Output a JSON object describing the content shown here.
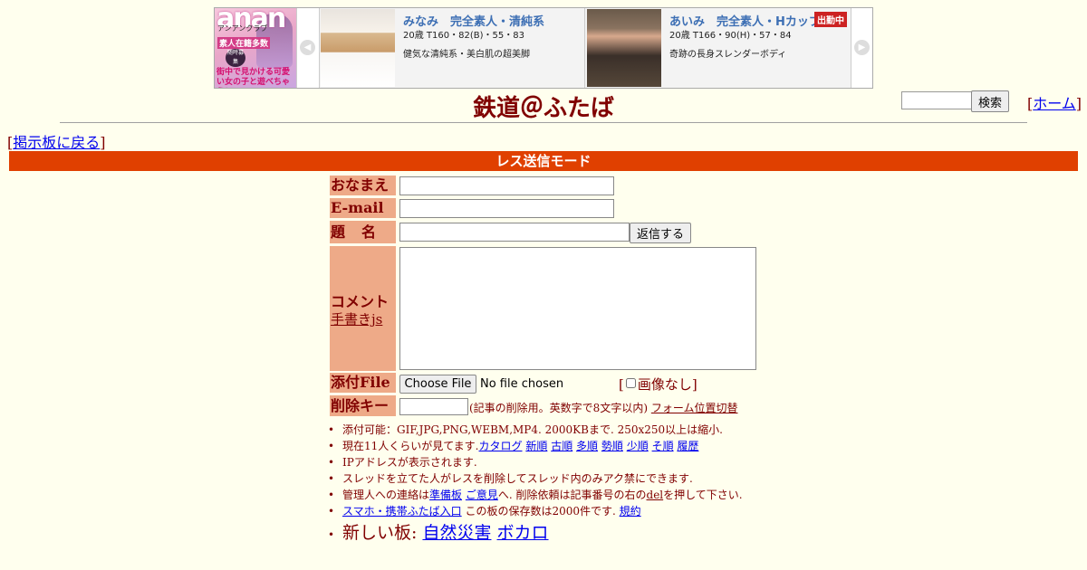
{
  "ad": {
    "logo": {
      "brand": "anan",
      "sub": "アンアンクラブ",
      "mid": "素人在籍多数",
      "bubble": "随時募集",
      "tagline": "街中で見かける可愛い女の子と遊べちゃう！"
    },
    "cards": [
      {
        "name": "みなみ　完全素人・清純系",
        "stats": "20歳 T160・82(B)・55・83",
        "desc": "健気な清純系・美白肌の超美脚",
        "badge": ""
      },
      {
        "name": "あいみ　完全素人・Hカップ",
        "stats": "20歳 T166・90(H)・57・84",
        "desc": "奇跡の長身スレンダーボディ",
        "badge": "出勤中"
      }
    ],
    "prev_glyph": "◀",
    "next_glyph": "▶"
  },
  "header": {
    "title": "鉄道＠ふたば",
    "search_button": "検索",
    "search_placeholder": "",
    "home_link": "ホーム",
    "back_link": "掲示板に戻る"
  },
  "mode_bar": "レス送信モード",
  "form": {
    "name_label": "おなまえ",
    "email_label": "E-mail",
    "subject_label": "題名",
    "reply_button": "返信する",
    "comment_label": "コメント",
    "handwriting_link": "手書きjs",
    "file_label": "添付File",
    "file_button": "Choose File",
    "file_status": "No file chosen",
    "noimage_label": "画像なし",
    "delkey_label": "削除キー",
    "delkey_note": "(記事の削除用。英数字で8文字以内)",
    "form_position_link": "フォーム位置切替"
  },
  "notes": {
    "attach": "添付可能：GIF,JPG,PNG,WEBM,MP4. 2000KBまで. 250x250以上は縮小.",
    "viewers_prefix": "現在11人くらいが見てます.",
    "sort_links": [
      "カタログ",
      "新順",
      "古順",
      "多順",
      "勢順",
      "少順",
      "そ順",
      "履歴"
    ],
    "ip": "IPアドレスが表示されます.",
    "thread_owner": "スレッドを立てた人がレスを削除してスレッド内のみアク禁にできます.",
    "contact_prefix": "管理人への連絡は",
    "contact_link1": "準備板",
    "contact_link2": "ご意見",
    "contact_suffix1": "へ. 削除依頼は記事番号の右の",
    "contact_del": "del",
    "contact_suffix2": "を押して下さい.",
    "mobile_link": "スマホ・携帯ふたば入口",
    "storage": " この板の保存数は2000件です.",
    "rules_link": "規約",
    "new_boards_prefix": "新しい板:",
    "new_board1": "自然災害",
    "new_board2": "ボカロ"
  }
}
